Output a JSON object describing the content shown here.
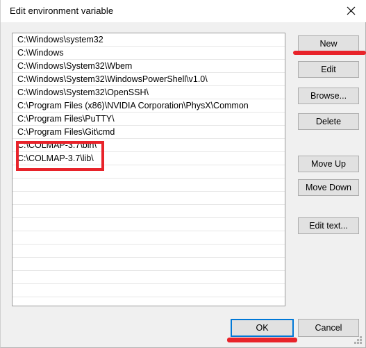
{
  "window": {
    "title": "Edit environment variable",
    "close_icon": "close-icon"
  },
  "path_list": {
    "entries": [
      "C:\\Windows\\system32",
      "C:\\Windows",
      "C:\\Windows\\System32\\Wbem",
      "C:\\Windows\\System32\\WindowsPowerShell\\v1.0\\",
      "C:\\Windows\\System32\\OpenSSH\\",
      "C:\\Program Files (x86)\\NVIDIA Corporation\\PhysX\\Common",
      "C:\\Program Files\\PuTTY\\",
      "C:\\Program Files\\Git\\cmd",
      "C:\\COLMAP-3.7\\bin\\",
      "C:\\COLMAP-3.7\\lib\\"
    ],
    "empty_row_count": 11
  },
  "side_buttons": {
    "new": "New",
    "edit": "Edit",
    "browse": "Browse...",
    "delete": "Delete",
    "move_up": "Move Up",
    "move_down": "Move Down",
    "edit_text": "Edit text..."
  },
  "footer_buttons": {
    "ok": "OK",
    "cancel": "Cancel"
  },
  "annotations": {
    "color": "#e8232a",
    "focus_color": "#0078d7",
    "new_underline": "red-underline-under-new-button",
    "ok_underline": "red-underline-under-ok-button",
    "colmap_box": "red-rectangle-around-colmap-entries"
  }
}
